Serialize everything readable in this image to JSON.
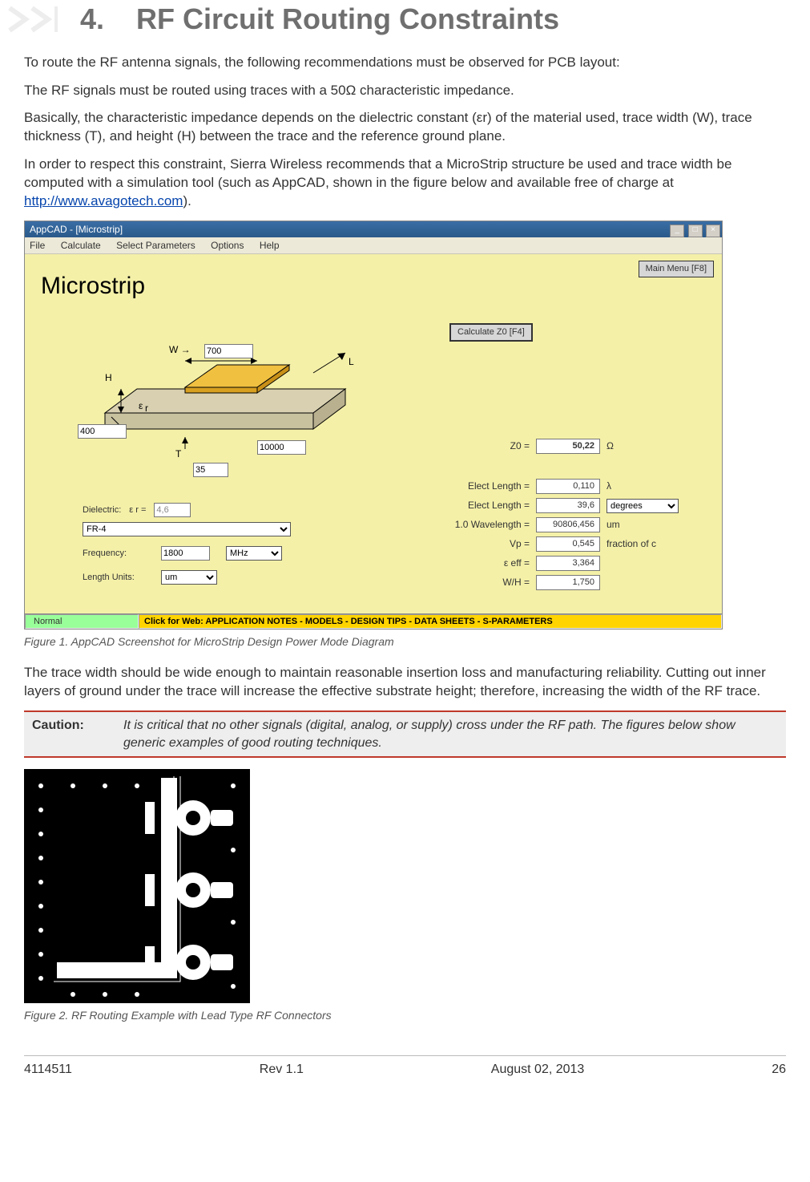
{
  "header": {
    "section_number": "4.",
    "section_title": "RF Circuit Routing Constraints"
  },
  "paragraphs": {
    "p1": "To route the RF antenna signals, the following recommendations must be observed for PCB layout:",
    "p2": "The RF signals must be routed using traces with a 50Ω characteristic impedance.",
    "p3": "Basically, the characteristic impedance depends on the dielectric constant (εr) of the material used, trace width (W), trace thickness (T), and height (H) between the trace and the reference ground plane.",
    "p4a": "In order to respect this constraint, Sierra Wireless recommends that a MicroStrip structure be used and trace width be computed with a simulation tool (such as AppCAD, shown in the figure below and available free of charge at ",
    "p4_link_text": "http://www.avagotech.com",
    "p4b": ").",
    "p5": "The trace width should be wide enough to maintain reasonable insertion loss and manufacturing reliability. Cutting out inner layers of ground under the trace will increase the effective substrate height; therefore, increasing the width of the RF trace."
  },
  "appcad": {
    "window_title": "AppCAD - [Microstrip]",
    "menu": [
      "File",
      "Calculate",
      "Select Parameters",
      "Options",
      "Help"
    ],
    "main_menu_btn": "Main Menu [F8]",
    "calc_btn": "Calculate Z0  [F4]",
    "heading": "Microstrip",
    "labels": {
      "W": "W",
      "W_val": "700",
      "H": "H",
      "H_val": "400",
      "T": "T",
      "T_val": "35",
      "L": "L",
      "L_val": "10000",
      "er": "εr",
      "dielectric": "Dielectric:",
      "er_small": "ε r =",
      "er_val": "4,6",
      "material": "FR-4",
      "frequency_lbl": "Frequency:",
      "frequency_val": "1800",
      "frequency_unit": "MHz",
      "length_units_lbl": "Length Units:",
      "length_units_val": "um"
    },
    "outputs": {
      "Z0_lbl": "Z0 =",
      "Z0_val": "50,22",
      "Z0_unit": "Ω",
      "el1_lbl": "Elect Length =",
      "el1_val": "0,110",
      "el1_unit": "λ",
      "el2_lbl": "Elect Length =",
      "el2_val": "39,6",
      "el2_unit": "degrees",
      "wl_lbl": "1.0 Wavelength =",
      "wl_val": "90806,456",
      "wl_unit": "um",
      "vp_lbl": "Vp =",
      "vp_val": "0,545",
      "vp_unit": "fraction of c",
      "eeff_lbl": "ε eff =",
      "eeff_val": "3,364",
      "wh_lbl": "W/H =",
      "wh_val": "1,750"
    },
    "status_normal": "Normal",
    "status_link": "Click for Web: APPLICATION NOTES - MODELS - DESIGN TIPS - DATA SHEETS - S-PARAMETERS"
  },
  "figure1": "Figure 1.      AppCAD Screenshot for MicroStrip Design Power Mode Diagram",
  "figure2": "Figure 2.      RF Routing Example with Lead Type RF Connectors",
  "caution": {
    "label": "Caution:",
    "text": "It is critical that no other signals (digital, analog, or supply) cross under the RF path. The figures below show generic examples of good routing techniques."
  },
  "footer": {
    "doc_id": "4114511",
    "rev": "Rev 1.1",
    "date": "August 02, 2013",
    "page": "26"
  }
}
